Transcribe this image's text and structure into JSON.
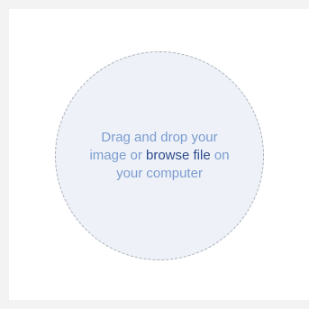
{
  "upload": {
    "line1": "Drag and drop your",
    "line2_prefix": "image or ",
    "browse_label": "browse file",
    "line2_suffix": " on",
    "line3": "your computer"
  },
  "colors": {
    "text": "#7c9ccf",
    "link": "#2c4a8c",
    "zone_fill": "#eef2f8",
    "zone_border": "#a9afb8"
  }
}
